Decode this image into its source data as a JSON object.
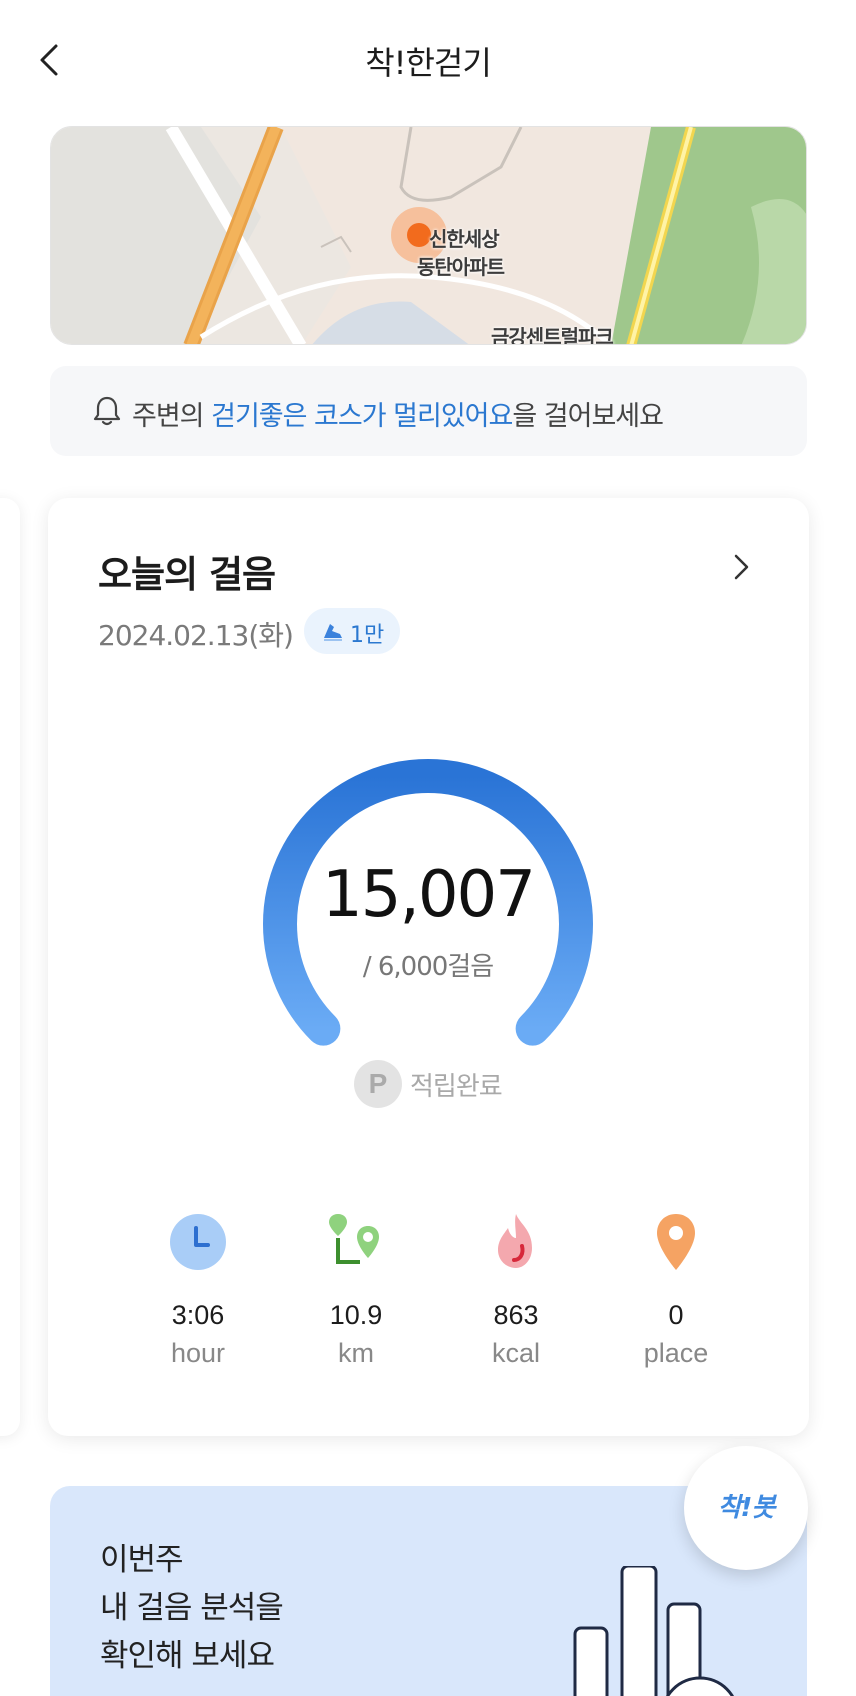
{
  "header": {
    "title": "착!한걷기",
    "back_icon": "chevron-left-icon"
  },
  "map": {
    "labels": {
      "apartment_line1": "신한세상",
      "apartment_line2": "동탄아파트",
      "park": "금강센트럴파크"
    },
    "marker_color": "#f26b1d"
  },
  "notice": {
    "icon": "bell-icon",
    "prefix": "주변의 ",
    "highlight": "걷기좋은 코스가 멀리있어요",
    "suffix": "을 걸어보세요"
  },
  "today": {
    "title": "오늘의 걸음",
    "date": "2024.02.13(화)",
    "badge_label": "1만",
    "steps": "15,007",
    "goal_text": "/ 6,000걸음",
    "progress_fraction": 1.0,
    "points_icon_letter": "P",
    "points_label": "적립완료",
    "stats": [
      {
        "icon": "clock-icon",
        "value": "3:06",
        "unit": "hour"
      },
      {
        "icon": "route-distance-icon",
        "value": "10.9",
        "unit": "km"
      },
      {
        "icon": "flame-icon",
        "value": "863",
        "unit": "kcal"
      },
      {
        "icon": "location-pin-icon",
        "value": "0",
        "unit": "place"
      }
    ]
  },
  "banner": {
    "line1": "이번주",
    "line2": "내 걸음 분석을",
    "line3": "확인해 보세요",
    "bot_label": "착!봇"
  },
  "colors": {
    "accent": "#2b78d0",
    "gauge_top": "#2a74d6",
    "gauge_bottom": "#6aabf5",
    "banner_bg": "#d9e7fb"
  }
}
